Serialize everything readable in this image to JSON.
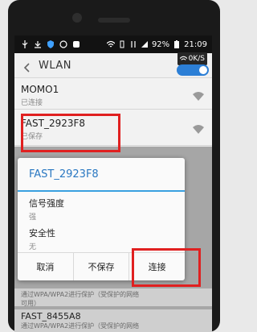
{
  "status_bar": {
    "battery": "92%",
    "time": "21:09"
  },
  "header": {
    "title": "WLAN",
    "rate_badge": "0K/S"
  },
  "networks": [
    {
      "name": "MOMO1",
      "status": "已连接"
    },
    {
      "name": "FAST_2923F8",
      "status": "已保存"
    }
  ],
  "dialog": {
    "title": "FAST_2923F8",
    "rows": [
      {
        "label": "信号强度",
        "value": "强"
      },
      {
        "label": "安全性",
        "value": "无"
      }
    ],
    "buttons": {
      "cancel": "取消",
      "forget": "不保存",
      "connect": "连接"
    }
  },
  "below_dialog": {
    "note_line1": "通过WPA/WPA2进行保护（受保护的网络",
    "note_line2": "可用）",
    "network_name": "FAST_8455A8",
    "network_note": "通过WPA/WPA2进行保护（受保护的网络"
  },
  "colors": {
    "accent": "#2a78c2",
    "highlight": "#e02020",
    "toggle": "#2c7fd6"
  }
}
